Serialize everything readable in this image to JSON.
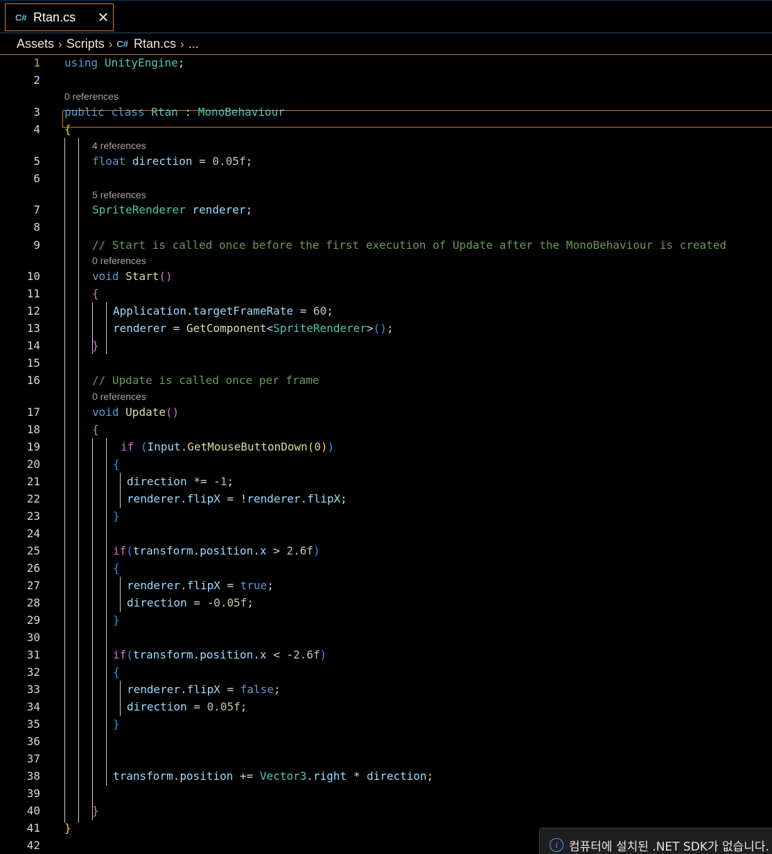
{
  "tab": {
    "icon": "csharp-file-icon",
    "title": "Rtan.cs",
    "close": "✕"
  },
  "breadcrumb": {
    "items": [
      "Assets",
      "Scripts",
      "Rtan.cs",
      "..."
    ]
  },
  "editor": {
    "active_line": 1,
    "line_numbers": [
      "1",
      "2",
      "3",
      "4",
      "5",
      "6",
      "7",
      "8",
      "9",
      "10",
      "11",
      "12",
      "13",
      "14",
      "15",
      "16",
      "17",
      "18",
      "19",
      "20",
      "21",
      "22",
      "23",
      "24",
      "25",
      "26",
      "27",
      "28",
      "29",
      "30",
      "31",
      "32",
      "33",
      "34",
      "35",
      "36",
      "37",
      "38",
      "39",
      "40",
      "41",
      "42"
    ],
    "code_lens": [
      "0 references",
      "4 references",
      "5 references",
      "0 references",
      "0 references"
    ],
    "lines": [
      [
        [
          "kw",
          "using"
        ],
        [
          "pl",
          " "
        ],
        [
          "ty",
          "UnityEngine"
        ],
        [
          "pl",
          ";"
        ]
      ],
      [],
      [
        [
          "kw",
          "public"
        ],
        [
          "pl",
          " "
        ],
        [
          "kw",
          "class"
        ],
        [
          "pl",
          " "
        ],
        [
          "ty",
          "Rtan"
        ],
        [
          "pl",
          " : "
        ],
        [
          "ty",
          "MonoBehaviour"
        ]
      ],
      [
        [
          "p1",
          "{"
        ]
      ],
      [
        [
          "kw",
          "float"
        ],
        [
          "pl",
          " "
        ],
        [
          "va",
          "direction"
        ],
        [
          "pl",
          " = "
        ],
        [
          "nu",
          "0.05f"
        ],
        [
          "pl",
          ";"
        ]
      ],
      [],
      [
        [
          "ty",
          "SpriteRenderer"
        ],
        [
          "pl",
          " "
        ],
        [
          "va",
          "renderer"
        ],
        [
          "pl",
          ";"
        ]
      ],
      [],
      [
        [
          "cm",
          "// Start is called once before the first execution of Update after the MonoBehaviour is created"
        ]
      ],
      [
        [
          "kw",
          "void"
        ],
        [
          "pl",
          " "
        ],
        [
          "fn",
          "Start"
        ],
        [
          "p2",
          "()"
        ]
      ],
      [
        [
          "p2",
          "{"
        ]
      ],
      [
        [
          "va",
          "Application"
        ],
        [
          "pl",
          "."
        ],
        [
          "va",
          "targetFrameRate"
        ],
        [
          "pl",
          " = "
        ],
        [
          "nu",
          "60"
        ],
        [
          "pl",
          ";"
        ]
      ],
      [
        [
          "va",
          "renderer"
        ],
        [
          "pl",
          " = "
        ],
        [
          "fn",
          "GetComponent"
        ],
        [
          "pl",
          "<"
        ],
        [
          "ty",
          "SpriteRenderer"
        ],
        [
          "pl",
          ">"
        ],
        [
          "p3",
          "()"
        ],
        [
          "pl",
          ";"
        ]
      ],
      [
        [
          "p2",
          "}"
        ]
      ],
      [],
      [
        [
          "cm",
          "// Update is called once per frame"
        ]
      ],
      [
        [
          "kw",
          "void"
        ],
        [
          "pl",
          " "
        ],
        [
          "fn",
          "Update"
        ],
        [
          "p2",
          "()"
        ]
      ],
      [
        [
          "p2",
          "{"
        ]
      ],
      [
        [
          "p2",
          "if"
        ],
        [
          "pl",
          " "
        ],
        [
          "p3",
          "("
        ],
        [
          "va",
          "Input"
        ],
        [
          "pl",
          "."
        ],
        [
          "fn",
          "GetMouseButtonDown"
        ],
        [
          "p1",
          "("
        ],
        [
          "nu",
          "0"
        ],
        [
          "p1",
          ")"
        ],
        [
          "p3",
          ")"
        ]
      ],
      [
        [
          "p3",
          "{"
        ]
      ],
      [
        [
          "va",
          "direction"
        ],
        [
          "pl",
          " *= -"
        ],
        [
          "nu",
          "1"
        ],
        [
          "pl",
          ";"
        ]
      ],
      [
        [
          "va",
          "renderer"
        ],
        [
          "pl",
          "."
        ],
        [
          "va",
          "flipX"
        ],
        [
          "pl",
          " = !"
        ],
        [
          "va",
          "renderer"
        ],
        [
          "pl",
          "."
        ],
        [
          "va",
          "flipX"
        ],
        [
          "pl",
          ";"
        ]
      ],
      [
        [
          "p3",
          "}"
        ]
      ],
      [],
      [
        [
          "p2",
          "if"
        ],
        [
          "p3",
          "("
        ],
        [
          "va",
          "transform"
        ],
        [
          "pl",
          "."
        ],
        [
          "va",
          "position"
        ],
        [
          "pl",
          "."
        ],
        [
          "va",
          "x"
        ],
        [
          "pl",
          " > "
        ],
        [
          "nu",
          "2.6f"
        ],
        [
          "p3",
          ")"
        ]
      ],
      [
        [
          "p3",
          "{"
        ]
      ],
      [
        [
          "va",
          "renderer"
        ],
        [
          "pl",
          "."
        ],
        [
          "va",
          "flipX"
        ],
        [
          "pl",
          " = "
        ],
        [
          "kw",
          "true"
        ],
        [
          "pl",
          ";"
        ]
      ],
      [
        [
          "va",
          "direction"
        ],
        [
          "pl",
          " = -"
        ],
        [
          "nu",
          "0.05f"
        ],
        [
          "pl",
          ";"
        ]
      ],
      [
        [
          "p3",
          "}"
        ]
      ],
      [],
      [
        [
          "p2",
          "if"
        ],
        [
          "p3",
          "("
        ],
        [
          "va",
          "transform"
        ],
        [
          "pl",
          "."
        ],
        [
          "va",
          "position"
        ],
        [
          "pl",
          "."
        ],
        [
          "va",
          "x"
        ],
        [
          "pl",
          " < -"
        ],
        [
          "nu",
          "2.6f"
        ],
        [
          "p3",
          ")"
        ]
      ],
      [
        [
          "p3",
          "{"
        ]
      ],
      [
        [
          "va",
          "renderer"
        ],
        [
          "pl",
          "."
        ],
        [
          "va",
          "flipX"
        ],
        [
          "pl",
          " = "
        ],
        [
          "kw",
          "false"
        ],
        [
          "pl",
          ";"
        ]
      ],
      [
        [
          "va",
          "direction"
        ],
        [
          "pl",
          " = "
        ],
        [
          "nu",
          "0.05f"
        ],
        [
          "pl",
          ";"
        ]
      ],
      [
        [
          "p3",
          "}"
        ]
      ],
      [],
      [],
      [
        [
          "va",
          "transform"
        ],
        [
          "pl",
          "."
        ],
        [
          "va",
          "position"
        ],
        [
          "pl",
          " += "
        ],
        [
          "ty",
          "Vector3"
        ],
        [
          "pl",
          "."
        ],
        [
          "va",
          "right"
        ],
        [
          "pl",
          " * "
        ],
        [
          "va",
          "direction"
        ],
        [
          "pl",
          ";"
        ]
      ],
      [],
      [
        [
          "p2",
          "}"
        ]
      ],
      [
        [
          "p1",
          "}"
        ]
      ],
      []
    ]
  },
  "notification": {
    "icon": "info-icon",
    "text": "컴퓨터에 설치된 .NET SDK가 없습니다."
  },
  "colors": {
    "accent_border": "#c9793a",
    "active_line_number": "#e8a33d",
    "keyword": "#569cd6",
    "type": "#4ec9b0",
    "comment": "#6a9955"
  }
}
